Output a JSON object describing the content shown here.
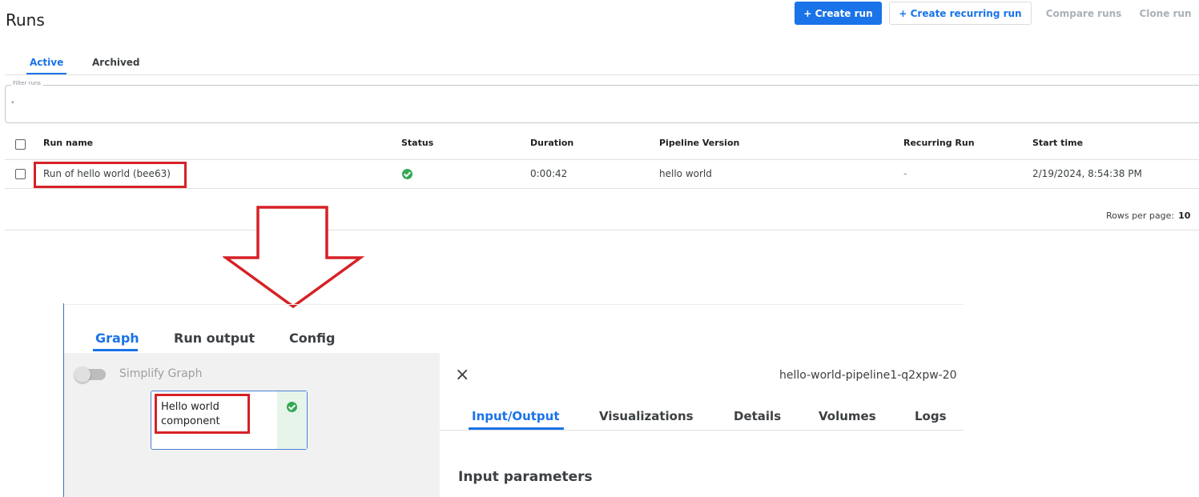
{
  "page": {
    "title": "Runs"
  },
  "toolbar": {
    "create_run": "+ Create run",
    "create_recurring_run": "+ Create recurring run",
    "compare_runs": "Compare runs",
    "clone_run": "Clone run"
  },
  "tabs": [
    {
      "label": "Active",
      "active": true
    },
    {
      "label": "Archived",
      "active": false
    }
  ],
  "filter": {
    "label": "Filter runs",
    "caret": "▾"
  },
  "table": {
    "columns": [
      "Run name",
      "Status",
      "Duration",
      "Pipeline Version",
      "Recurring Run",
      "Start time"
    ],
    "rows": [
      {
        "run_name": "Run of hello world (bee63)",
        "status": "success",
        "duration": "0:00:42",
        "pipeline_version": "hello world",
        "recurring_run": "-",
        "start_time": "2/19/2024, 8:54:38 PM"
      }
    ]
  },
  "pagination": {
    "rows_per_page_label": "Rows per page:",
    "rows_per_page_value": "10"
  },
  "run_detail": {
    "tabs": [
      "Graph",
      "Run output",
      "Config"
    ],
    "simplify_graph_label": "Simplify Graph",
    "node_label": "Hello world component",
    "node_status": "success",
    "run_id": "hello-world-pipeline1-q2xpw-20",
    "close_icon": "×",
    "detail_tabs": [
      "Input/Output",
      "Visualizations",
      "Details",
      "Volumes",
      "Logs"
    ],
    "section_title": "Input parameters"
  },
  "colors": {
    "accent": "#1a73e8",
    "highlight": "#d62126",
    "success": "#34a853"
  }
}
